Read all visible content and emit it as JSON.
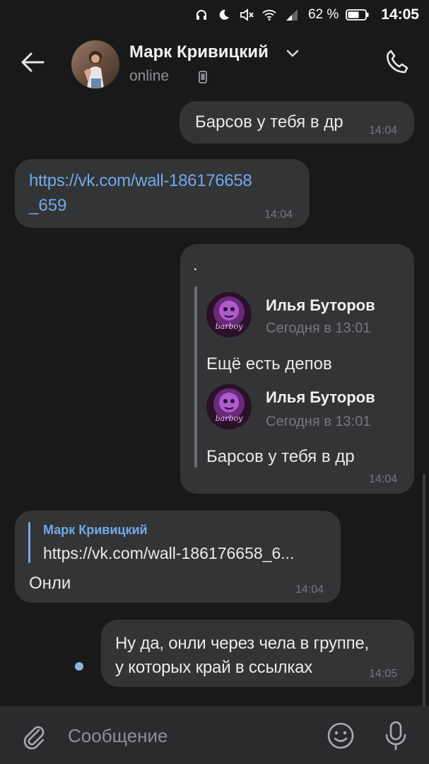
{
  "status_bar": {
    "icons": [
      "headset-icon",
      "moon-icon",
      "mute-icon",
      "wifi-icon",
      "signal-icon",
      "battery-icon"
    ],
    "battery": "62 %",
    "time": "14:05"
  },
  "header": {
    "contact_name": "Марк Кривицкий",
    "presence": "online",
    "icons": [
      "back-arrow-icon",
      "chevron-down-icon",
      "phone-device-icon",
      "call-icon"
    ]
  },
  "messages": [
    {
      "text": "Барсов у тебя в др",
      "time": "14:04"
    },
    {
      "line1": "https://vk.com/wall-186176658",
      "line2": "_659",
      "time": "14:04"
    },
    {
      "text": ".",
      "forwards": [
        {
          "name": "Илья Буторов",
          "date": "Сегодня в 13:01",
          "text": "Ещё есть депов",
          "avatar_caption": "barboy"
        },
        {
          "name": "Илья Буторов",
          "date": "Сегодня в 13:01",
          "text": "Барсов у тебя в др",
          "avatar_caption": "barboy"
        }
      ],
      "time": "14:04"
    },
    {
      "reply_author": "Марк Кривицкий",
      "reply_text": "https://vk.com/wall-186176658_6...",
      "text": "Онли",
      "time": "14:04"
    },
    {
      "line1": "Ну да, онли через чела в группе,",
      "line2": "у которых край в ссылках",
      "time": "14:05"
    }
  ],
  "composer": {
    "placeholder": "Сообщение",
    "icons": [
      "paperclip-icon",
      "emoji-icon",
      "microphone-icon"
    ]
  },
  "colors": {
    "background": "#19191a",
    "bubble": "#333436",
    "link": "#71aaeb",
    "composer": "#2b2b2d"
  }
}
